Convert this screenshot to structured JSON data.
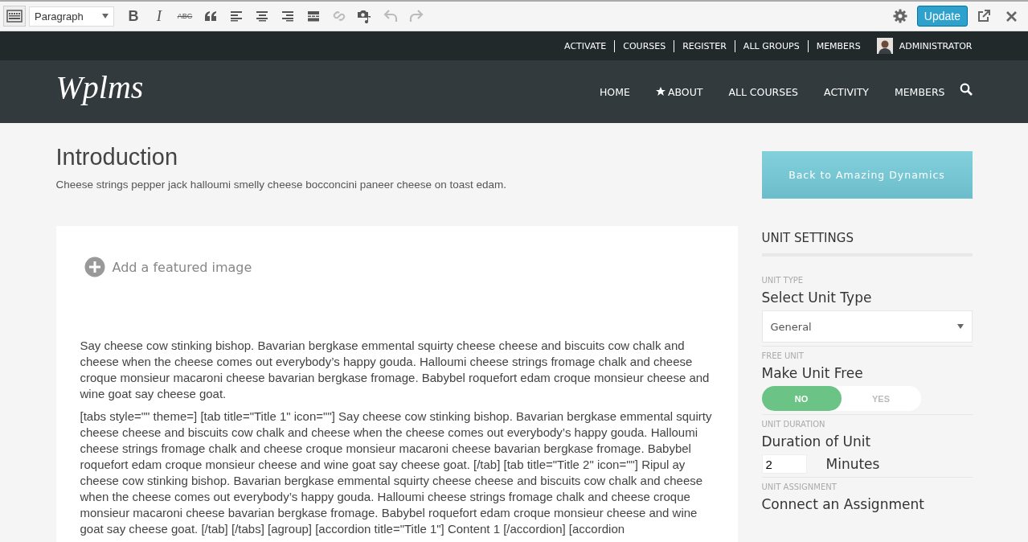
{
  "toolbar": {
    "format": "Paragraph",
    "tools": [
      {
        "kind": "keyboard",
        "disabled": false
      },
      {
        "kind": "bold",
        "glyph": "B",
        "disabled": false
      },
      {
        "kind": "italic",
        "glyph": "I",
        "disabled": false
      },
      {
        "kind": "strike",
        "glyph": "ABC",
        "disabled": false
      },
      {
        "kind": "quote",
        "disabled": false
      },
      {
        "kind": "align-left",
        "disabled": false
      },
      {
        "kind": "align-center",
        "disabled": false
      },
      {
        "kind": "align-right",
        "disabled": false
      },
      {
        "kind": "more",
        "disabled": false
      },
      {
        "kind": "link",
        "disabled": true
      },
      {
        "kind": "media",
        "disabled": false
      },
      {
        "kind": "undo",
        "disabled": true
      },
      {
        "kind": "redo",
        "disabled": true
      }
    ],
    "update_button": "Update"
  },
  "top_bar": {
    "links": [
      "ACTIVATE",
      "COURSES",
      "REGISTER",
      "ALL GROUPS",
      "MEMBERS"
    ],
    "user": "ADMINISTRATOR"
  },
  "header": {
    "logo": "Wplms",
    "nav": [
      {
        "label": "HOME",
        "star": false
      },
      {
        "label": "ABOUT",
        "star": true
      },
      {
        "label": "ALL COURSES",
        "star": false
      },
      {
        "label": "ACTIVITY",
        "star": false
      },
      {
        "label": "MEMBERS",
        "star": false
      }
    ]
  },
  "page": {
    "title": "Introduction",
    "subtitle": "Cheese strings pepper jack halloumi smelly cheese bocconcini paneer cheese on toast edam."
  },
  "editor": {
    "featured_image": "Add a featured image",
    "paragraphs": [
      "Say cheese cow stinking bishop. Bavarian bergkase emmental squirty cheese cheese and biscuits cow chalk and cheese when the cheese comes out everybody’s happy gouda. Halloumi cheese strings fromage chalk and cheese croque monsieur macaroni cheese bavarian bergkase fromage. Babybel roquefort edam croque monsieur cheese and wine goat say cheese goat.",
      "[tabs style=\"\" theme=] [tab title=\"Title 1\" icon=\"\"] Say cheese cow stinking bishop. Bavarian bergkase emmental squirty cheese cheese and biscuits cow chalk and cheese when the cheese comes out everybody’s happy gouda. Halloumi cheese strings fromage chalk and cheese croque monsieur macaroni cheese bavarian bergkase fromage. Babybel roquefort edam croque monsieur cheese and wine goat say cheese goat. [/tab] [tab title=\"Title 2\" icon=\"\"] Ripul ay cheese cow stinking bishop. Bavarian bergkase emmental squirty cheese cheese and biscuits cow chalk and cheese when the cheese comes out everybody’s happy gouda. Halloumi cheese strings fromage chalk and cheese croque monsieur macaroni cheese bavarian bergkase fromage. Babybel roquefort edam croque monsieur cheese and wine goat say cheese goat. [/tab] [/tabs] [agroup] [accordion title=\"Title 1\"] Content 1 [/accordion] [accordion"
    ]
  },
  "sidebar": {
    "back_button": "Back to Amazing Dynamics",
    "heading": "UNIT SETTINGS",
    "sections": [
      {
        "kind": "select",
        "caption": "UNIT TYPE",
        "label": "Select Unit Type",
        "value": "General"
      },
      {
        "kind": "toggle",
        "caption": "FREE UNIT",
        "label": "Make Unit Free",
        "options": [
          {
            "label": "NO",
            "selected": true
          },
          {
            "label": "YES",
            "selected": false
          }
        ]
      },
      {
        "kind": "duration",
        "caption": "UNIT DURATION",
        "label": "Duration of Unit",
        "value": "2",
        "unit": "Minutes"
      },
      {
        "kind": "heading",
        "caption": "UNIT ASSIGNMENT",
        "label": "Connect an Assignment"
      }
    ]
  }
}
